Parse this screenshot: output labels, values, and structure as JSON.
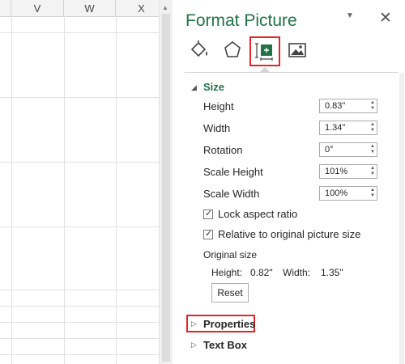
{
  "sheet": {
    "columns": [
      "V",
      "W",
      "X"
    ]
  },
  "pane": {
    "title": "Format Picture",
    "options_icon": "chevron-down-icon",
    "close_icon": "close-icon",
    "close_label": "✕",
    "options_label": "▼",
    "tabs": [
      {
        "name": "fill-line-icon"
      },
      {
        "name": "effects-icon"
      },
      {
        "name": "size-properties-icon",
        "selected": true
      },
      {
        "name": "picture-icon"
      }
    ],
    "accent": "#217346",
    "highlight": "#e0262a"
  },
  "size": {
    "title": "Size",
    "height_label": "Height",
    "height_value": "0.83\"",
    "width_label": "Width",
    "width_value": "1.34\"",
    "rotation_label": "Rotation",
    "rotation_value": "0°",
    "scale_height_label": "Scale Height",
    "scale_height_value": "101%",
    "scale_width_label": "Scale Width",
    "scale_width_value": "100%",
    "lock_aspect_label": "Lock aspect ratio",
    "lock_aspect_checked": true,
    "relative_label": "Relative to original picture size",
    "relative_checked": true,
    "original_size_label": "Original size",
    "orig_height_label": "Height:",
    "orig_height_value": "0.82\"",
    "orig_width_label": "Width:",
    "orig_width_value": "1.35\"",
    "reset_label": "Reset"
  },
  "sections": {
    "properties": "Properties",
    "text_box": "Text Box"
  }
}
